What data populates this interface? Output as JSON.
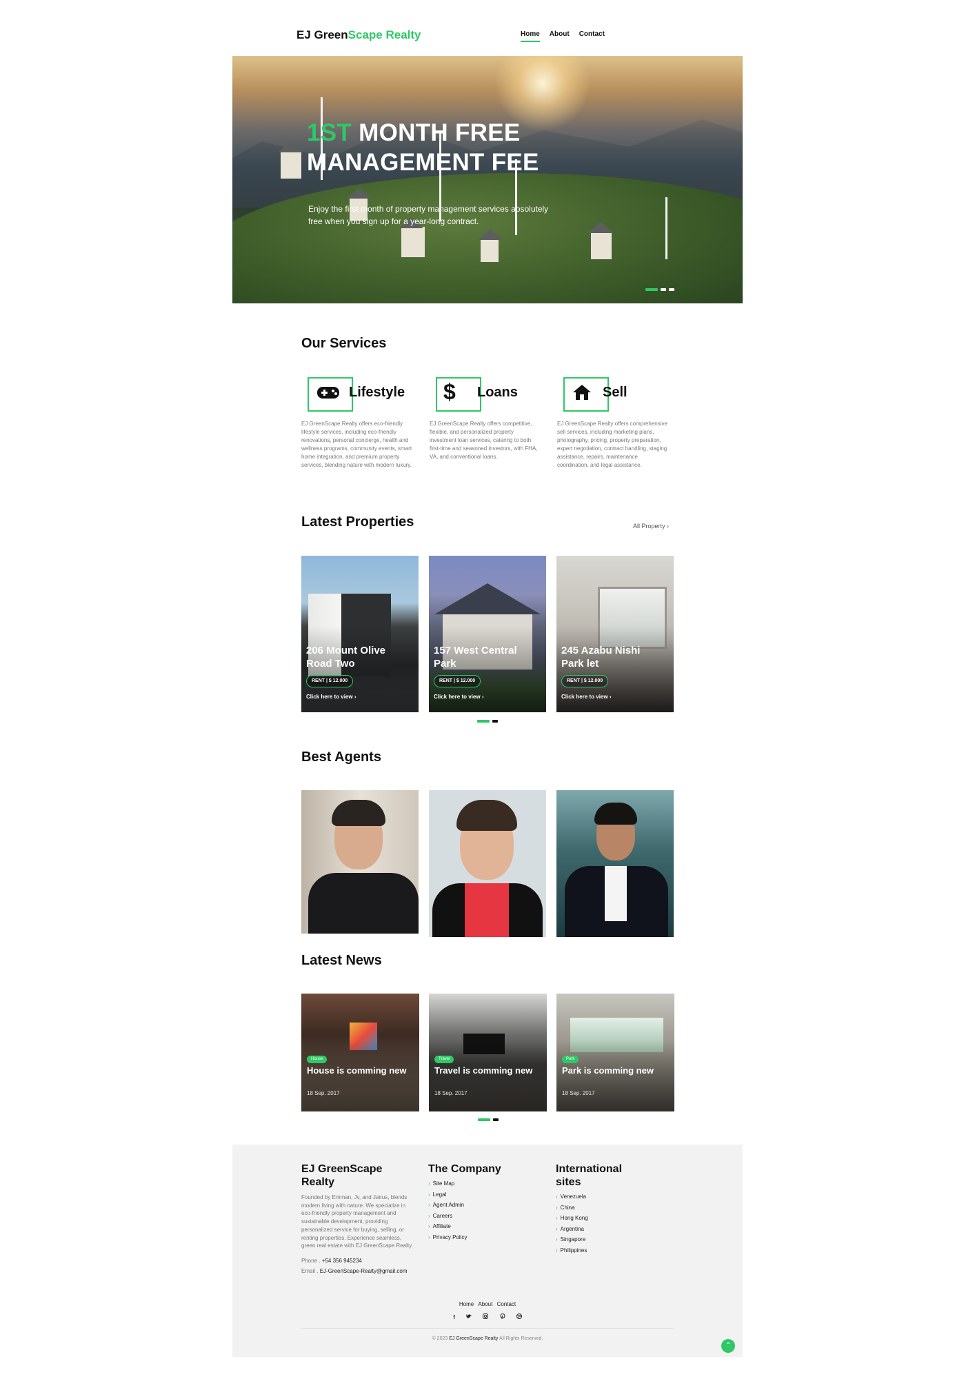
{
  "header": {
    "logo_part1": "EJ Green",
    "logo_part2": "Scape Realty",
    "nav": [
      "Home",
      "About",
      "Contact"
    ]
  },
  "hero": {
    "title_accent": "1ST",
    "title_rest": " MONTH FREE",
    "title_line2": "MANAGEMENT FEE",
    "text": "Enjoy the first month of property management services absolutely free when you sign up for a year-long contract.",
    "slides": 3,
    "active_slide": 1
  },
  "services": {
    "heading": "Our Services",
    "items": [
      {
        "title": "Lifestyle",
        "icon": "gamepad-icon",
        "desc": "EJ GreenScape Realty offers eco-friendly lifestyle services, including eco-friendly renovations, personal concierge, health and wellness programs, community events, smart home integration, and premium property services, blending nature with modern luxury."
      },
      {
        "title": "Loans",
        "icon": "dollar-icon",
        "desc": "EJ GreenScape Realty offers competitive, flexible, and personalized property investment loan services, catering to both first-time and seasoned investors, with FHA, VA, and conventional loans."
      },
      {
        "title": "Sell",
        "icon": "house-icon",
        "desc": "EJ GreenScape Realty offers comprehensive sell services, including marketing plans, photography, pricing, property preparation, expert negotiation, contract handling, staging assistance, repairs, maintenance coordination, and legal assistance."
      }
    ]
  },
  "properties": {
    "heading": "Latest Properties",
    "all_link": "All Property",
    "items": [
      {
        "title": "206 Mount Olive Road Two",
        "price": "RENT | $ 12.000",
        "cta": "Click here to view"
      },
      {
        "title": "157 West Central Park",
        "price": "RENT | $ 12.000",
        "cta": "Click here to view"
      },
      {
        "title": "245 Azabu Nishi Park let",
        "price": "RENT | $ 12.000",
        "cta": "Click here to view"
      }
    ]
  },
  "agents": {
    "heading": "Best Agents"
  },
  "news": {
    "heading": "Latest News",
    "items": [
      {
        "tag": "House",
        "title": "House is comming new",
        "date": "18 Sep. 2017"
      },
      {
        "tag": "Travel",
        "title": "Travel is comming new",
        "date": "18 Sep. 2017"
      },
      {
        "tag": "Park",
        "title": "Park is comming new",
        "date": "18 Sep. 2017"
      }
    ]
  },
  "footer": {
    "brand": "EJ GreenScape Realty",
    "desc": "Founded by Emman, Jv, and Jairus, blends modern living with nature. We specialize in eco-friendly property management and sustainable development, providing personalized service for buying, selling, or renting properties. Experience seamless, green real estate with EJ GreenScape Realty.",
    "phone_label": "Phone .",
    "phone": "+54 356 945234",
    "email_label": "Email .",
    "email": "EJ-GreenScape-Realty@gmail.com",
    "company_heading": "The Company",
    "company_links": [
      "Site Map",
      "Legal",
      "Agent Admin",
      "Careers",
      "Affiliate",
      "Privacy Policy"
    ],
    "intl_heading": "International sites",
    "intl_links": [
      "Venezuela",
      "China",
      "Hong Kong",
      "Argentina",
      "Singapore",
      "Philippines"
    ],
    "bottom_nav": [
      "Home",
      "About",
      "Contact"
    ],
    "social": [
      "facebook-icon",
      "twitter-icon",
      "instagram-icon",
      "pinterest-icon",
      "dribbble-icon"
    ],
    "copyright_pre": "© 2023",
    "copyright_brand": "EJ GreenScape Realty",
    "copyright_post": "All Rights Reserved."
  },
  "colors": {
    "accent": "#2ec866",
    "footer_bg": "#f2f2f2"
  }
}
